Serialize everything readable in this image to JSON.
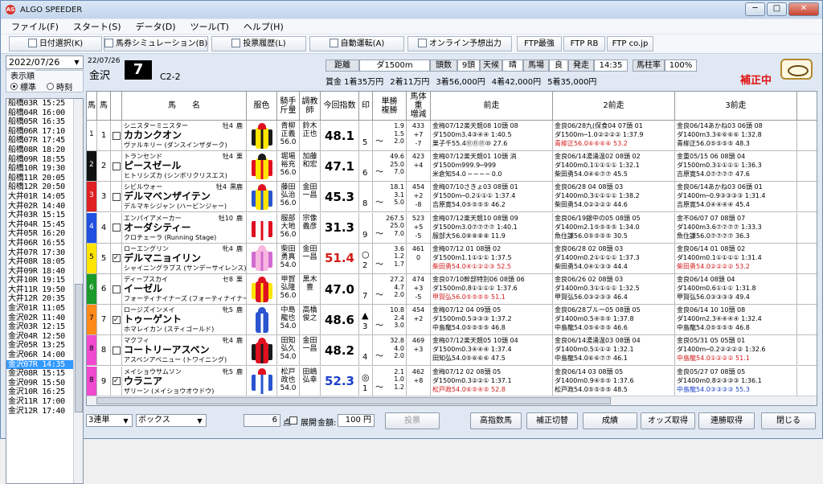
{
  "window": {
    "title": "ALGO SPEEDER",
    "minimize": "─",
    "maximize": "□",
    "close": "✕"
  },
  "menu": [
    "ファイル(F)",
    "スタート(S)",
    "データ(D)",
    "ツール(T)",
    "ヘルプ(H)"
  ],
  "toolbar": [
    {
      "label": "日付選択(K)",
      "icon": "search-icon"
    },
    {
      "label": "馬券シミュレーション(B)",
      "icon": "ticket-icon"
    },
    {
      "label": "投票履歴(L)",
      "icon": "history-icon"
    },
    {
      "label": "自動運転(A)",
      "icon": "auto-icon"
    },
    {
      "label": "オンライン予想出力",
      "icon": "online-icon"
    },
    {
      "label": "FTP最強",
      "icon": ""
    },
    {
      "label": "FTP RB",
      "icon": ""
    },
    {
      "label": "FTP co.jp",
      "icon": ""
    }
  ],
  "left": {
    "date": "2022/07/26",
    "display_label": "表示順",
    "radio_standard": "標準",
    "radio_time": "時刻",
    "races": [
      "船橋03R 15:25",
      "船橋04R 16:00",
      "船橋05R 16:35",
      "船橋06R 17:10",
      "船橋07R 17:45",
      "船橋08R 18:20",
      "船橋09R 18:55",
      "船橋10R 19:30",
      "船橋11R 20:05",
      "船橋12R 20:50",
      "大井01R 14:05",
      "大井02R 14:40",
      "大井03R 15:15",
      "大井04R 15:45",
      "大井05R 16:20",
      "大井06R 16:55",
      "大井07R 17:30",
      "大井08R 18:05",
      "大井09R 18:40",
      "大井10R 19:15",
      "大井11R 19:50",
      "大井12R 20:35",
      "金沢01R 11:05",
      "金沢02R 11:40",
      "金沢03R 12:15",
      "金沢04R 12:50",
      "金沢05R 13:25",
      "金沢06R 14:00",
      "金沢07R 14:35",
      "金沢08R 15:15",
      "金沢09R 15:50",
      "金沢10R 16:25",
      "金沢11R 17:00",
      "金沢12R 17:40"
    ],
    "selected_index": 28
  },
  "race": {
    "date": "22/07/26",
    "venue": "金沢",
    "number": "7",
    "class": "C2-2",
    "distance_label": "距離",
    "distance": "ダ1500m",
    "heads_label": "頭数",
    "heads": "9頭",
    "weather_label": "天候",
    "weather": "晴",
    "track_label": "馬場",
    "track": "良",
    "post_label": "発走",
    "post": "14:35",
    "rate_label": "馬柱率",
    "rate": "100%",
    "prizes": [
      "賞金 1着35万円",
      "2着11万円",
      "3着56,000円",
      "4着42,000円",
      "5着35,000円"
    ],
    "correction": "補正中"
  },
  "columns": [
    "馬",
    "馬",
    "馬　　名",
    "服色",
    "騎手\n斤量",
    "調教\n師",
    "今回指数",
    "印",
    "単勝\n複勝",
    "馬体重\n増減",
    "前走",
    "2前走",
    "3前走"
  ],
  "horses": [
    {
      "waku": "1",
      "wcolor": "#ffffff",
      "num": "1",
      "check": "",
      "sire": "シニスターミニスター",
      "sex": "牡4",
      "coat": "鹿",
      "name": "カカンクオン",
      "dam": "ヴァルキリー (ダンスインザダーク)",
      "silk": [
        "#ffe400",
        "#1a1a1a",
        "#e01020"
      ],
      "jockey": [
        "青柳",
        "正義",
        "56.0"
      ],
      "trainer": [
        "鈴木",
        "正也"
      ],
      "index": "48.1",
      "icolor": "#000",
      "mark": "",
      "mnum": "5",
      "odds": [
        "1.9",
        "1.5",
        "2.0"
      ],
      "weight": [
        "433",
        "+7",
        "-7"
      ],
      "r1": [
        "金梅07/12楽天競08 10頭 08",
        "ダ1500m3.4③④④ 1:40.5",
        "栗子千55.4⑪⑪⑪⑩ 27.6"
      ],
      "r1c": "#000",
      "r2": [
        "金良06/28九(保食04 07頭 01",
        "ダ1500m─1.0②②②② 1:37.9",
        "青柳正56.0⑥⑥⑥⑥ 53.2"
      ],
      "r2c": "#d21a1a",
      "r3": [
        "金良06/14あかね03 06頭 08",
        "ダ1400m3.3⑥⑥⑥⑥ 1:32.8",
        "青柳正56.0⑤⑤⑤⑤ 48.3"
      ],
      "r3c": "#000"
    },
    {
      "waku": "2",
      "wcolor": "#111111",
      "num": "2",
      "check": "",
      "sire": "トランセンド",
      "sex": "牡4",
      "coat": "栗",
      "name": "ピースゼール",
      "dam": "ヒトリシズカ (シンボリクリスエス)",
      "silk": [
        "#ffe400",
        "#e01020",
        "#1a1a1a"
      ],
      "jockey": [
        "堀場",
        "裕充",
        "56.0"
      ],
      "trainer": [
        "加藤",
        "和宏"
      ],
      "index": "47.1",
      "icolor": "#000",
      "mark": "",
      "mnum": "6",
      "odds": [
        "49.6",
        "25.0",
        "7.0"
      ],
      "weight": [
        "423",
        "+4",
        ""
      ],
      "r1": [
        "金梅07/12楽天競01 10頭 消",
        "ダ1500m999.9─999",
        "米倉知54.0 ─ ─ ─ ─ 0.0"
      ],
      "r1c": "#000",
      "r2": [
        "金良06/14湯涌温02 08頭 02",
        "ダ1400m0.1①①①① 1:32.1",
        "柴田勇54.0④⑥⑦⑦ 45.5"
      ],
      "r2c": "#000",
      "r3": [
        "金重05/15 06 08頭 04",
        "ダ1500m0.3①①①① 1:36.3",
        "吉原寛54.0⑦⑦⑦⑦ 47.6"
      ],
      "r3c": "#000"
    },
    {
      "waku": "3",
      "wcolor": "#e02020",
      "num": "3",
      "check": "",
      "sire": "シビルウォー",
      "sex": "牡4",
      "coat": "黒鹿",
      "name": "デルマベンザイテン",
      "dam": "デルマキシジャン (ハービンジャー)",
      "silk": [
        "#ffe400",
        "#2a54d0",
        "#e01020"
      ],
      "jockey": [
        "藤田",
        "弘治",
        "56.0"
      ],
      "trainer": [
        "金田",
        "一昌"
      ],
      "index": "45.3",
      "icolor": "#000",
      "mark": "",
      "mnum": "8",
      "odds": [
        "18.1",
        "3.1",
        "5.0"
      ],
      "weight": [
        "454",
        "+2",
        "-8"
      ],
      "r1": [
        "金梅07/10さきょ03 08頭 01",
        "ダ1500m─0.2①①① 1:37.4",
        "吉原寛54.0⑤⑤⑤⑤ 46.2"
      ],
      "r1c": "#000",
      "r2": [
        "金良06/28 04 08頭 03",
        "ダ1400m0.3①①①① 1:38.2",
        "柴田勇54.0②②②② 44.6"
      ],
      "r2c": "#000",
      "r3": [
        "金良06/14あかね03 06頭 01",
        "ダ1400m─0.9③③③③ 1:31.4",
        "吉原寛54.0④④④④ 45.4"
      ],
      "r3c": "#000"
    },
    {
      "waku": "4",
      "wcolor": "#2050e0",
      "num": "4",
      "check": "",
      "sire": "エンパイアメーカー",
      "sex": "牡10",
      "coat": "鹿",
      "name": "オーダシティー",
      "dam": "クロチェーラ (Running Stage)",
      "silk": [
        "#ffffff",
        "#e01020",
        "#ffffff"
      ],
      "jockey": [
        "服部",
        "大地",
        "56.0"
      ],
      "trainer": [
        "宗像",
        "義彦"
      ],
      "index": "31.3",
      "icolor": "#000",
      "mark": "",
      "mnum": "9",
      "odds": [
        "267.5",
        "25.0",
        "7.0"
      ],
      "weight": [
        "523",
        "+5",
        "-5"
      ],
      "r1": [
        "金梅07/12楽天競10 08頭 09",
        "ダ1500m3.0⑦⑦⑦⑦ 1:40.1",
        "服部大56.0⑧⑧⑧⑧ 11.9"
      ],
      "r1c": "#000",
      "r2": [
        "金良06/19銀中の05 08頭 05",
        "ダ1400m2.1⑤⑤⑤⑤ 1:34.0",
        "魚住謙56.0⑤⑤⑤⑤ 30.5"
      ],
      "r2c": "#000",
      "r3": [
        "金不06/07 07 08頭 07",
        "ダ1400m3.6⑦⑦⑦⑦ 1:33.3",
        "魚住謙56.0⑦⑦⑦⑦ 36.3"
      ],
      "r3c": "#000"
    },
    {
      "waku": "5",
      "wcolor": "#ffe400",
      "num": "5",
      "check": "✓",
      "sire": "ローエングリン",
      "sex": "牝4",
      "coat": "鹿",
      "name": "デルマニョイリン",
      "dam": "シャイニングラブス (サンデーサイレンス)",
      "silk": [
        "#f7b6e0",
        "#d26bd0",
        "#f7b6e0"
      ],
      "jockey": [
        "柴田",
        "勇真",
        "54.0"
      ],
      "trainer": [
        "金田",
        "一昌"
      ],
      "index": "51.4",
      "icolor": "#d21a1a",
      "mark": "○",
      "mnum": "2",
      "odds": [
        "3.6",
        "1.2",
        "1.7"
      ],
      "weight": [
        "461",
        "0",
        ""
      ],
      "r1": [
        "金梅07/12 01 08頭 02",
        "ダ1500m1.1①①① 1:37.5",
        "柴田勇54.0④①②②③ 52.5"
      ],
      "r1c": "#d21a1a",
      "r2": [
        "金良06/28 02 08頭 03",
        "ダ1400m0.2①①①① 1:37.3",
        "柴田勇54.0④①③③ 44.4"
      ],
      "r2c": "#000",
      "r3": [
        "金良06/14 01 08頭 02",
        "ダ1400m0.1①①①① 1:31.4",
        "柴田勇54.0②②②② 53.2"
      ],
      "r3c": "#d21a1a"
    },
    {
      "waku": "6",
      "wcolor": "#1a9a2a",
      "num": "6",
      "check": "",
      "sire": "ディープスカイ",
      "sex": "セ8",
      "coat": "栗",
      "name": "イーゼル",
      "dam": "フォーティナイナーズ (フォーティナイナー)",
      "silk": [
        "#e01020",
        "#ffe400",
        "#e01020"
      ],
      "jockey": [
        "甲賀",
        "弘隆",
        "56.0"
      ],
      "trainer": [
        "黒木",
        "豊"
      ],
      "index": "47.0",
      "icolor": "#000",
      "mark": "",
      "mnum": "7",
      "odds": [
        "27.2",
        "4.7",
        "2.0"
      ],
      "weight": [
        "474",
        "+3",
        "-5"
      ],
      "r1": [
        "金良07/10幹部特別06 08頭 06",
        "ダ1500m0.8①①①① 1:37.6",
        "甲賀弘56.0⑤⑤⑤⑤ 51.1"
      ],
      "r1c": "#d21a1a",
      "r2": [
        "金良06/26 02 08頭 03",
        "ダ1400m0.3①①①① 1:32.5",
        "甲賀弘56.0③②③③ 46.4"
      ],
      "r2c": "#000",
      "r3": [
        "金良06/14 08頭 04",
        "ダ1400m0.6①①① 1:31.8",
        "甲賀弘56.0③③③③ 49.4"
      ],
      "r3c": "#000"
    },
    {
      "waku": "7",
      "wcolor": "#ff8a1a",
      "num": "7",
      "check": "✓",
      "sire": "ロージズインメイ",
      "sex": "牝5",
      "coat": "鹿",
      "name": "トゥーゲント",
      "dam": "ホマレイカン (スティゴールド)",
      "silk": [
        "#2a54d0",
        "#ffffff",
        "#2a54d0"
      ],
      "jockey": [
        "中島",
        "龍也",
        "54.0"
      ],
      "trainer": [
        "高橋",
        "俊之"
      ],
      "index": "48.6",
      "icolor": "#000",
      "mark": "▲",
      "mnum": "3",
      "odds": [
        "10.8",
        "2.4",
        "3.0"
      ],
      "weight": [
        "454",
        "+2",
        ""
      ],
      "r1": [
        "金梅07/12 04 09頭 05",
        "ダ1500m0.5③③③ 1:37.2",
        "中島龍54.0⑤⑤⑤⑤ 46.8"
      ],
      "r1c": "#000",
      "r2": [
        "金良06/28ブルー05 08頭 05",
        "ダ1400m0.5④⑤⑤ 1:37.8",
        "中島龍54.0⑤⑥⑤⑤ 46.6"
      ],
      "r2c": "#000",
      "r3": [
        "金良06/14 10 10頭 08",
        "ダ1400m2.3④④④④ 1:32.4",
        "中島龍54.0⑤⑤⑤⑤ 46.8"
      ],
      "r3c": "#000"
    },
    {
      "waku": "8",
      "wcolor": "#f04ad0",
      "num": "8",
      "check": "",
      "sire": "マクフィ",
      "sex": "牝4",
      "coat": "鹿",
      "name": "コートリーアスベン",
      "dam": "アスベンアベニュー (トワイニング)",
      "silk": [
        "#e01020",
        "#1a1a1a",
        "#e01020"
      ],
      "jockey": [
        "田知",
        "弘久",
        "54.0"
      ],
      "trainer": [
        "金田",
        "一昌"
      ],
      "index": "48.2",
      "icolor": "#000",
      "mark": "",
      "mnum": "4",
      "odds": [
        "32.8",
        "4.0",
        "2.0"
      ],
      "weight": [
        "469",
        "+3",
        ""
      ],
      "r1": [
        "金梅07/12楽天競05 10頭 04",
        "ダ1500m0.3④④④ 1:37.4",
        "田知弘54.0⑤⑥⑥⑥ 47.5"
      ],
      "r1c": "#000",
      "r2": [
        "金良06/14湯涌温03 08頭 04",
        "ダ1400m0.5①①② 1:32.1",
        "中島龍54.0⑥⑥⑦⑦ 46.1"
      ],
      "r2c": "#000",
      "r3": [
        "金良05/31 05 05頭 01",
        "ダ1400m─0.2②②②② 1:32.6",
        "中島龍54.0①②②② 51.1"
      ],
      "r3c": "#d21a1a"
    },
    {
      "waku": "8",
      "wcolor": "#f04ad0",
      "num": "9",
      "check": "✓",
      "sire": "メイショウサムソン",
      "sex": "牝5",
      "coat": "鹿",
      "name": "ウラニア",
      "dam": "ザリーン (メイショウオウドウ)",
      "silk": [
        "#ffffff",
        "#2a54d0",
        "#e01020"
      ],
      "jockey": [
        "松戸",
        "政也",
        "54.0"
      ],
      "trainer": [
        "田嶋",
        "弘幸"
      ],
      "index": "52.3",
      "icolor": "#1c3fc8",
      "mark": "◎",
      "mnum": "1",
      "odds": [
        "2.1",
        "1.0",
        "1.2"
      ],
      "weight": [
        "462",
        "+8",
        ""
      ],
      "r1": [
        "金梅07/12 02 08頭 05",
        "ダ1500m0.3②②① 1:37.1",
        "松戸政54.0⑥⑤④⑤ 52.8"
      ],
      "r1c": "#d21a1a",
      "r2": [
        "金良06/14 03 08頭 05",
        "ダ1400m0.9④⑤⑤ 1:37.6",
        "松戸政54.0⑤⑤⑤⑤ 48.5"
      ],
      "r2c": "#000",
      "r3": [
        "金良05/27 07 08頭 05",
        "ダ1400m0.8②③③③ 1:36.1",
        "中島龍54.0③③③③ 55.3"
      ],
      "r3c": "#1c3fc8"
    }
  ],
  "bottom": {
    "bet_type": "3連単",
    "bet_method": "ボックス",
    "points": "6",
    "points_label": "点",
    "expand_label": "展開",
    "amount_label": "金額:",
    "amount": "100 円",
    "vote": "投票",
    "buttons": [
      "高指数馬",
      "補正切替",
      "成績",
      "オッズ取得",
      "連勝取得",
      "閉じる"
    ]
  }
}
